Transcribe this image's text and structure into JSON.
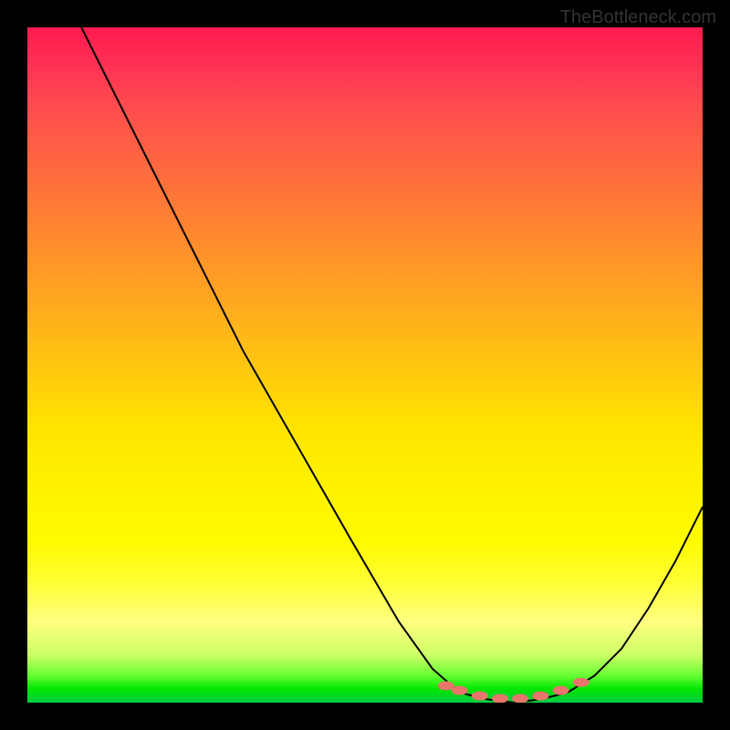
{
  "watermark": "TheBottleneck.com",
  "chart_data": {
    "type": "line",
    "title": "",
    "xlabel": "",
    "ylabel": "",
    "xlim": [
      0,
      100
    ],
    "ylim": [
      0,
      100
    ],
    "curve_points": [
      {
        "x": 8,
        "y": 100
      },
      {
        "x": 12,
        "y": 92
      },
      {
        "x": 18,
        "y": 80
      },
      {
        "x": 25,
        "y": 66
      },
      {
        "x": 32,
        "y": 52
      },
      {
        "x": 40,
        "y": 38
      },
      {
        "x": 48,
        "y": 24
      },
      {
        "x": 55,
        "y": 12
      },
      {
        "x": 60,
        "y": 5
      },
      {
        "x": 64,
        "y": 1.5
      },
      {
        "x": 68,
        "y": 0.5
      },
      {
        "x": 72,
        "y": 0
      },
      {
        "x": 76,
        "y": 0.5
      },
      {
        "x": 80,
        "y": 1.5
      },
      {
        "x": 84,
        "y": 4
      },
      {
        "x": 88,
        "y": 8
      },
      {
        "x": 92,
        "y": 14
      },
      {
        "x": 96,
        "y": 21
      },
      {
        "x": 100,
        "y": 29
      }
    ],
    "markers": [
      {
        "x": 62,
        "y": 2.5
      },
      {
        "x": 64,
        "y": 1.8
      },
      {
        "x": 67,
        "y": 1.0
      },
      {
        "x": 70,
        "y": 0.6
      },
      {
        "x": 73,
        "y": 0.6
      },
      {
        "x": 76,
        "y": 1.0
      },
      {
        "x": 79,
        "y": 1.8
      },
      {
        "x": 82,
        "y": 3.0
      }
    ],
    "marker_color": "#e8756b",
    "curve_color": "#000000",
    "gradient_meaning": "bottleneck severity (red=high, green=optimal)"
  }
}
